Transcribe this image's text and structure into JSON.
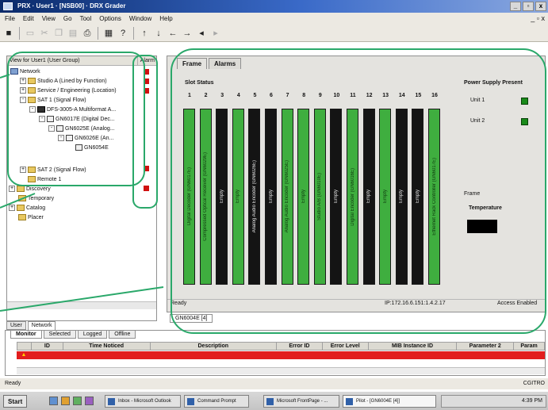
{
  "window": {
    "title": "PRX · User1 · [NSB00] · DRX Grader",
    "controls": [
      "_",
      "▫",
      "x"
    ]
  },
  "menu": {
    "items": [
      "File",
      "Edit",
      "View",
      "Go",
      "Tool",
      "Options",
      "Window",
      "Help"
    ],
    "right": "_ ▫ x"
  },
  "toolbar": {
    "icons": [
      "save-icon",
      "open-icon",
      "cut-icon",
      "copy-icon",
      "paste-icon",
      "print-icon",
      "calc-icon",
      "help-icon",
      "arrow-up-icon",
      "arrow-down-icon",
      "arrow-left-icon",
      "arrow-right-icon",
      "back-icon",
      "forward-icon"
    ]
  },
  "tree": {
    "header": {
      "view": "View for User1 (User Group)",
      "alarm": "Alarm"
    },
    "nodes": [
      {
        "label": "Network",
        "expander": "",
        "icon": "network"
      },
      {
        "label": "Studio A (Lined by Function)",
        "expander": "+",
        "icon": "folder"
      },
      {
        "label": "Service / Engineering (Location)",
        "expander": "+",
        "icon": "folder"
      },
      {
        "label": "SAT 1 (Signal Flow)",
        "expander": "-",
        "icon": "folder"
      },
      {
        "label": "DFS-3005-A Multiformat A...",
        "expander": "-",
        "icon": "chassis"
      },
      {
        "label": "GN6017E (Digital Dec...",
        "expander": "-",
        "icon": "card"
      },
      {
        "label": "GN6025E (Analog...",
        "expander": "-",
        "icon": "card"
      },
      {
        "label": "GN6026E (An...",
        "expander": "-",
        "icon": "card"
      },
      {
        "label": "GN6054E",
        "expander": "",
        "icon": "card"
      },
      {
        "label": "SAT 2 (Signal Flow)",
        "expander": "+",
        "icon": "folder"
      },
      {
        "label": "Remote 1",
        "expander": "",
        "icon": "folder"
      },
      {
        "label": "Discovery",
        "expander": "+",
        "icon": "folder"
      },
      {
        "label": "Temporary",
        "expander": "",
        "icon": "folder"
      },
      {
        "label": "Catalog",
        "expander": "+",
        "icon": "folder"
      },
      {
        "label": "Placer",
        "expander": "",
        "icon": "folder"
      }
    ],
    "tabs": [
      "User",
      "Network"
    ]
  },
  "panel": {
    "tabs": [
      "Frame",
      "Alarms"
    ],
    "slot_status_label": "Slot Status",
    "slot_numbers": [
      "1",
      "2",
      "3",
      "4",
      "5",
      "6",
      "7",
      "8",
      "9",
      "10",
      "11",
      "12",
      "13",
      "14",
      "15",
      "16"
    ],
    "slots": [
      {
        "label": "Digital Decoder (GN6017E)",
        "state": "green"
      },
      {
        "label": "Compressed Optical Receiver (GN6029E)",
        "state": "green"
      },
      {
        "label": "Empty",
        "state": "black"
      },
      {
        "label": "Empty",
        "state": "green"
      },
      {
        "label": "Analog Audio Encoder (GN6026E)",
        "state": "black"
      },
      {
        "label": "Empty",
        "state": "black"
      },
      {
        "label": "Analog Audio Encoder (GN6025E)",
        "state": "green"
      },
      {
        "label": "Empty",
        "state": "green"
      },
      {
        "label": "Studio A/B (GN6010E)",
        "state": "green"
      },
      {
        "label": "Empty",
        "state": "black"
      },
      {
        "label": "Digital Encoder (GN6016E)",
        "state": "green"
      },
      {
        "label": "Empty",
        "state": "black"
      },
      {
        "label": "Empty",
        "state": "green"
      },
      {
        "label": "Empty",
        "state": "black"
      },
      {
        "label": "Empty",
        "state": "black"
      },
      {
        "label": "Ethernet Rack Controller (GN6017E)",
        "state": "green"
      }
    ],
    "power_supply": {
      "title": "Power Supply Present",
      "units": [
        "Unit 1",
        "Unit 2"
      ]
    },
    "frame_label": "Frame",
    "temperature_label": "Temperature",
    "status": {
      "left": "Ready",
      "ip": "IP:172.16.6.151:1.4.2.17",
      "access": "Access Enabled"
    },
    "device_tab": "GN6004E [4]"
  },
  "monitor": {
    "tabs": [
      "Monitor",
      "Selected",
      "Logged",
      "Offline"
    ],
    "columns": [
      "",
      "ID",
      "Time Noticed",
      "Description",
      "Error ID",
      "Error Level",
      "MIB Instance ID",
      "Parameter 2",
      "Param"
    ],
    "row": [
      "",
      "",
      "",
      "",
      "",
      "",
      "",
      "",
      ""
    ]
  },
  "app_status": {
    "left": "Ready",
    "right": "CGITRO"
  },
  "taskbar": {
    "start": "Start",
    "items": [
      "Inbox - Microsoft Outlook",
      "Command Prompt",
      "Microsoft FrontPage - ...",
      "Pilot - [GN6004E [4]]"
    ],
    "tray": "4:39 PM"
  },
  "colors": {
    "slot_green": "#3fae3f",
    "slot_black": "#141414",
    "alarm_red": "#d01010",
    "annotation": "#2aa86a"
  }
}
